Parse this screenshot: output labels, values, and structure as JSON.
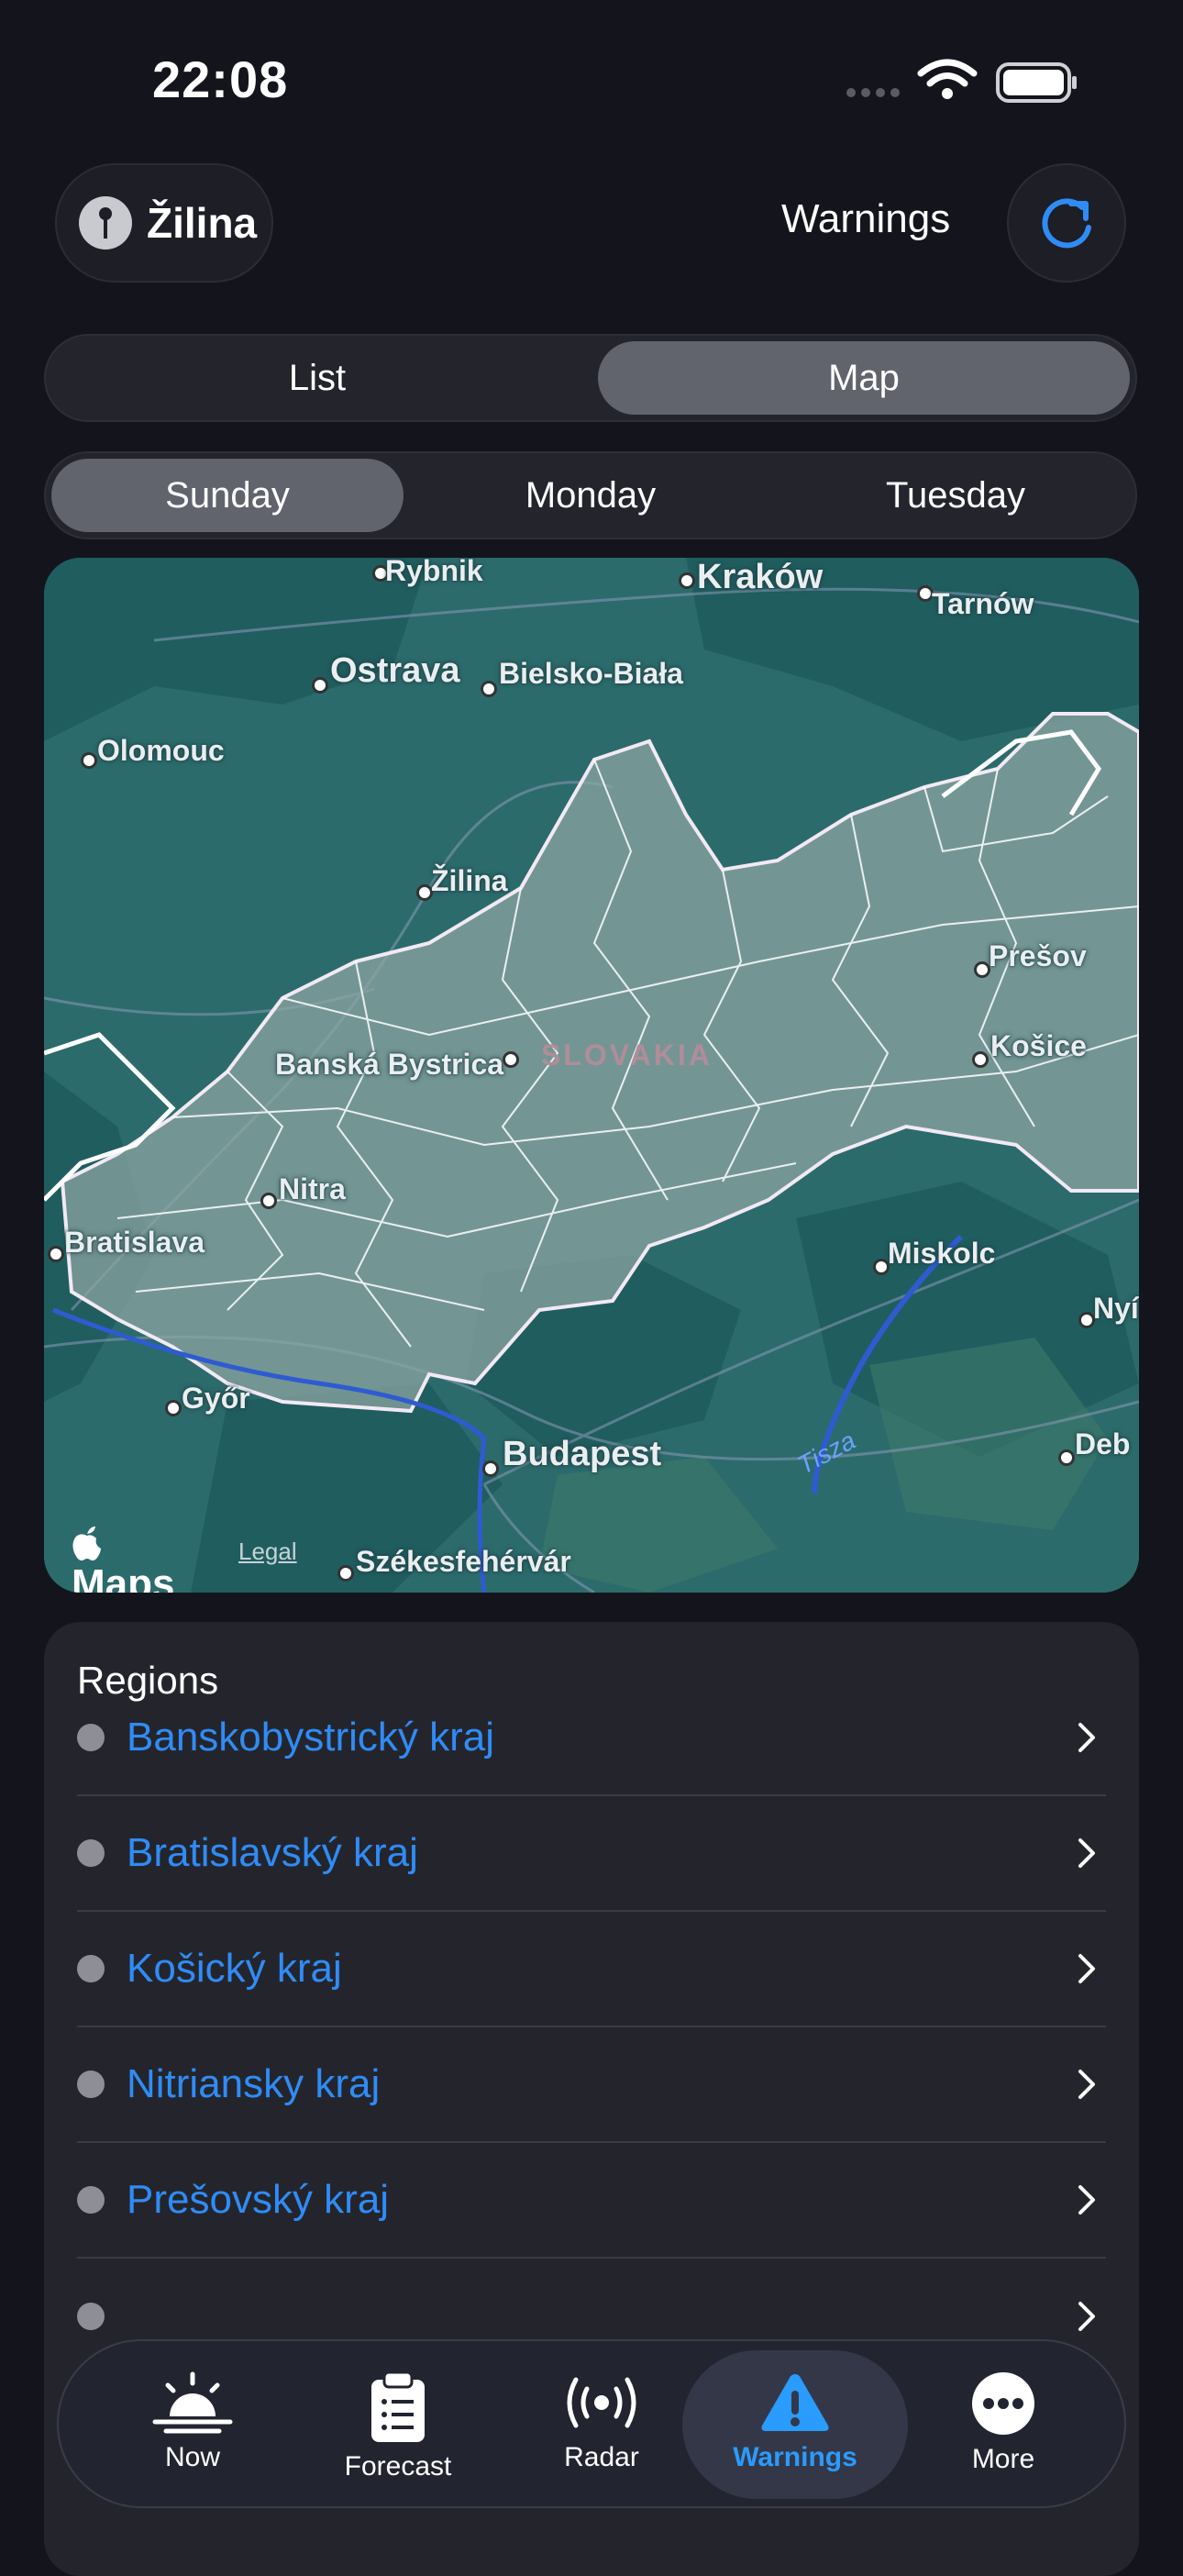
{
  "status_bar": {
    "time": "22:08"
  },
  "header": {
    "location": "Žilina",
    "title": "Warnings"
  },
  "view_toggle": {
    "items": [
      "List",
      "Map"
    ],
    "selected": "Map"
  },
  "day_toggle": {
    "items": [
      "Sunday",
      "Monday",
      "Tuesday"
    ],
    "selected": "Sunday"
  },
  "map": {
    "country_label": "SLOVAKIA",
    "city_labels": [
      "Rybnik",
      "Kraków",
      "Tarnów",
      "Ostrava",
      "Bielsko-Biała",
      "Olomouc",
      "Žilina",
      "Prešov",
      "Banská Bystrica",
      "Košice",
      "Nitra",
      "Bratislava",
      "Miskolc",
      "Nyí",
      "Győr",
      "Budapest",
      "Deb",
      "Székesfehérvár"
    ],
    "river_label": "Tisza",
    "attribution": "Maps",
    "legal": "Legal"
  },
  "regions": {
    "title": "Regions",
    "items": [
      "Banskobystrický kraj",
      "Bratislavský kraj",
      "Košický kraj",
      "Nitriansky kraj",
      "Prešovský kraj"
    ]
  },
  "tabbar": {
    "items": [
      "Now",
      "Forecast",
      "Radar",
      "Warnings",
      "More"
    ],
    "selected": "Warnings"
  },
  "colors": {
    "accent": "#2f8cf6",
    "background": "#14151c",
    "card": "#24252c"
  },
  "icons": [
    "pin-icon",
    "refresh-icon",
    "chevron-right-icon",
    "sunrise-icon",
    "clipboard-icon",
    "radar-icon",
    "warning-icon",
    "more-icon"
  ]
}
